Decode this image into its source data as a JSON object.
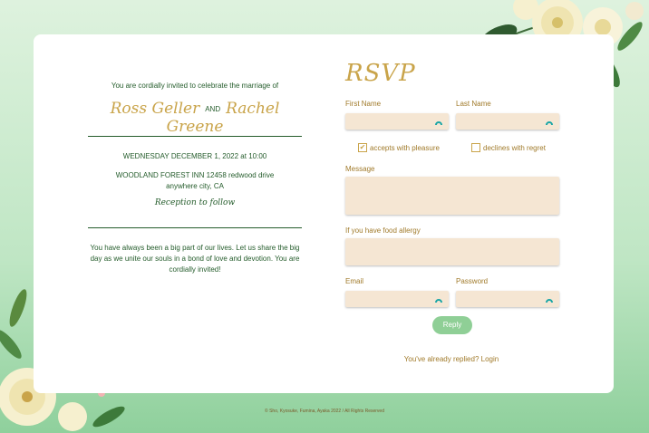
{
  "invitation": {
    "intro": "You are cordially invited to celebrate the marriage of",
    "groom": "Ross Geller",
    "and": "AND",
    "bride": "Rachel Greene",
    "date": "WEDNESDAY DECEMBER 1, 2022 at 10:00",
    "venue_line1": "WOODLAND FOREST INN 12458 redwood drive",
    "venue_line2": "anywhere city, CA",
    "reception": "Reception to follow",
    "message": "You have always been a big part of our lives. Let us share the big day as we unite our souls in a bond of love and devotion. You are cordially invited!"
  },
  "rsvp": {
    "title": "RSVP",
    "first_name_label": "First Name",
    "last_name_label": "Last Name",
    "accept_label": "accepts with pleasure",
    "accept_checked": true,
    "decline_label": "declines with regret",
    "decline_checked": false,
    "message_label": "Message",
    "allergy_label": "If you have food allergy",
    "email_label": "Email",
    "password_label": "Password",
    "reply_button": "Reply",
    "login_link": "You've already replied? Login",
    "checkmark": "✔"
  },
  "footer": {
    "copyright": "© Sho, Kyosuke, Fumina, Ayaka 2022 / All Rights Reserved"
  },
  "icons": {
    "field_key": "key-icon",
    "decor": "flower-icon"
  },
  "colors": {
    "accent_gold": "#c9a44a",
    "text_green": "#245c2b",
    "field_bg": "#f5e6d3",
    "button_green": "#8fcf96"
  }
}
